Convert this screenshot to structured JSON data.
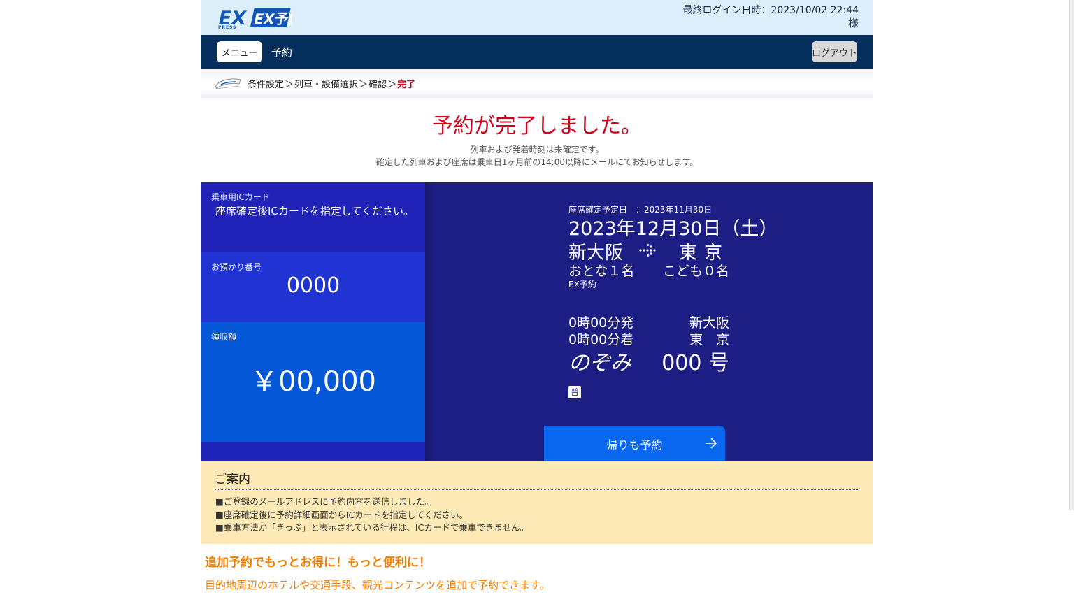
{
  "header": {
    "logo_text": "EX予約",
    "last_login": "最終ログイン日時：2023/10/02 22:44",
    "user_suffix": "様"
  },
  "nav": {
    "menu_label": "メニュー",
    "title": "予約",
    "logout_label": "ログアウト"
  },
  "breadcrumb": {
    "steps": [
      "条件設定",
      "列車・設備選択",
      "確認",
      "完了"
    ],
    "separator": "＞"
  },
  "completion": {
    "title": "予約が完了しました。",
    "note_1": "列車および発着時刻は未確定です。",
    "note_2": "確定した列車および座席は乗車日1ヶ月前の14:00以降にメールにてお知らせします。"
  },
  "ic_card": {
    "label": "乗車用ICカード",
    "text": "座席確定後ICカードを指定してください。"
  },
  "reservation_number": {
    "label": "お預かり番号",
    "value": "0000"
  },
  "receipt": {
    "label": "領収額",
    "value": "￥00,000"
  },
  "trip": {
    "confirm_date": "座席確定予定日　：2023年11月30日",
    "travel_date": "2023年12月30日（土）",
    "from": "新大阪",
    "to": "東京",
    "adults": "おとな１名",
    "children": "こども０名",
    "ticket_type": "EX予約",
    "depart_time": "0時00分発",
    "depart_station": "新大阪",
    "arrive_time": "0時00分着",
    "arrive_station": "東　京",
    "train_name": "のぞみ",
    "train_number": "000 号",
    "seat_class_badge": "普"
  },
  "return_button": {
    "label": "帰りも予約"
  },
  "info": {
    "title": "ご案内",
    "items": [
      "■ご登録のメールアドレスに予約内容を送信しました。",
      "■座席確定後に予約詳細画面からICカードを指定してください。",
      "■乗車方法が「きっぷ」と表示されている行程は、ICカードで乗車できません。"
    ]
  },
  "promo": {
    "title": "追加予約でもっとお得に！もっと便利に！",
    "text": "目的地周辺のホテルや交通手段、観光コンテンツを追加で予約できます。"
  },
  "colors": {
    "header_bg": "#dbeefa",
    "nav_bg": "#042f5c",
    "accent_red": "#d0021b",
    "panel_bg": "#1d1e84",
    "button_blue": "#0a68f0",
    "info_bg": "#fde9b6",
    "promo_orange": "#ef7d00"
  }
}
